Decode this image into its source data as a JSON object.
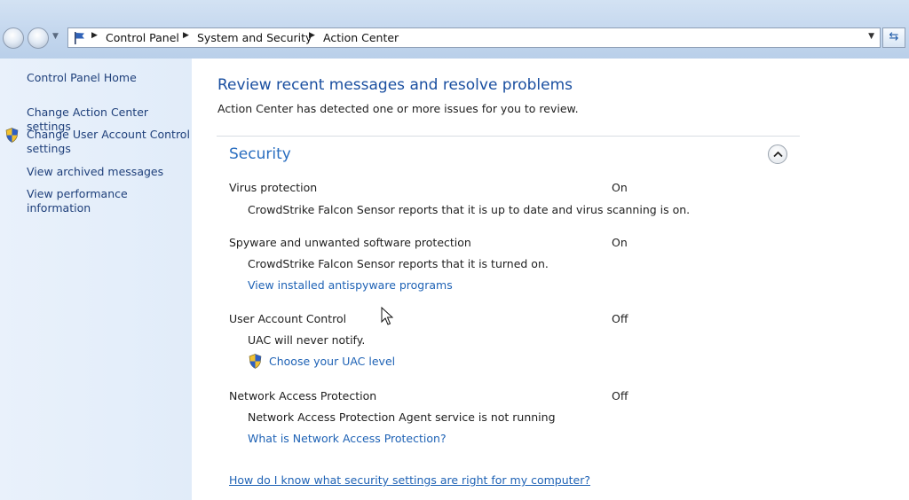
{
  "addressbar": {
    "breadcrumbs": [
      "Control Panel",
      "System and Security",
      "Action Center"
    ]
  },
  "sidebar": {
    "items": [
      {
        "label": "Control Panel Home"
      },
      {
        "label": "Change Action Center settings"
      },
      {
        "label": "Change User Account Control settings",
        "line1": "Change User Account Control",
        "line2": "settings"
      },
      {
        "label": "View archived messages"
      },
      {
        "label": "View performance information"
      }
    ]
  },
  "main": {
    "title": "Review recent messages and resolve problems",
    "subtitle": "Action Center has detected one or more issues for you to review.",
    "section": {
      "title": "Security",
      "items": [
        {
          "name": "Virus protection",
          "status": "On",
          "description": "CrowdStrike Falcon Sensor reports that it is up to date and virus scanning is on."
        },
        {
          "name": "Spyware and unwanted software protection",
          "status": "On",
          "description": "CrowdStrike Falcon Sensor reports that it is turned on.",
          "link": "View installed antispyware programs"
        },
        {
          "name": "User Account Control",
          "status": "Off",
          "description": "UAC will never notify.",
          "link": "Choose your UAC level"
        },
        {
          "name": "Network Access Protection",
          "status": "Off",
          "description": "Network Access Protection Agent service is not running",
          "link": "What is Network Access Protection?"
        }
      ]
    },
    "help_link": "How do I know what security settings are right for my computer?"
  }
}
